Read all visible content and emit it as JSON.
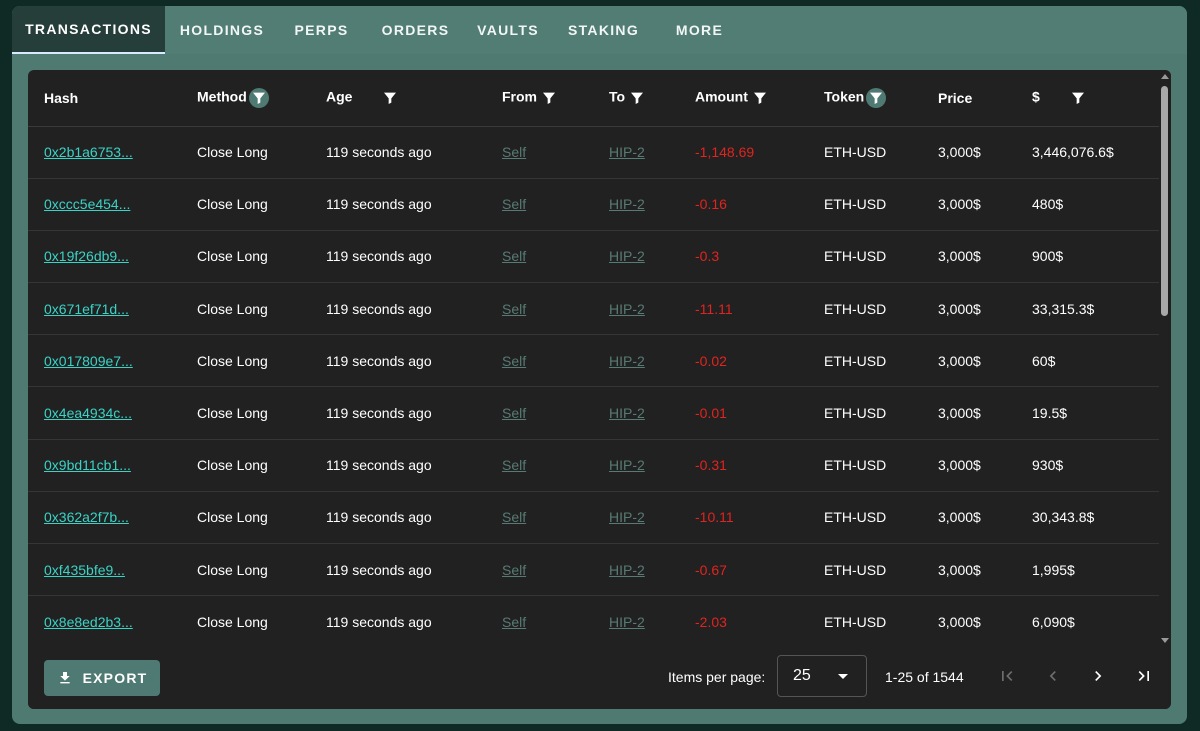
{
  "tabs": [
    {
      "label": "TRANSACTIONS",
      "active": true
    },
    {
      "label": "HOLDINGS"
    },
    {
      "label": "PERPS"
    },
    {
      "label": "ORDERS"
    },
    {
      "label": "VAULTS"
    },
    {
      "label": "STAKING"
    },
    {
      "label": "MORE"
    }
  ],
  "table": {
    "columns": [
      {
        "key": "hash",
        "label": "Hash",
        "filter": "none"
      },
      {
        "key": "method",
        "label": "Method",
        "filter": "filter-circle-icon"
      },
      {
        "key": "age",
        "label": "Age",
        "filter": "filter-icon"
      },
      {
        "key": "from",
        "label": "From",
        "filter": "filter-icon"
      },
      {
        "key": "to",
        "label": "To",
        "filter": "filter-icon"
      },
      {
        "key": "amount",
        "label": "Amount",
        "filter": "filter-icon"
      },
      {
        "key": "token",
        "label": "Token",
        "filter": "filter-circle-icon"
      },
      {
        "key": "price",
        "label": "Price",
        "filter": "none"
      },
      {
        "key": "usd",
        "label": "$",
        "filter": "filter-icon"
      }
    ],
    "rows": [
      {
        "hash": "0x2b1a6753...",
        "method": "Close Long",
        "age": "119 seconds ago",
        "from": "Self",
        "to": "HIP-2",
        "amount": "-1,148.69",
        "token": "ETH-USD",
        "price": "3,000$",
        "usd": "3,446,076.6$"
      },
      {
        "hash": "0xccc5e454...",
        "method": "Close Long",
        "age": "119 seconds ago",
        "from": "Self",
        "to": "HIP-2",
        "amount": "-0.16",
        "token": "ETH-USD",
        "price": "3,000$",
        "usd": "480$"
      },
      {
        "hash": "0x19f26db9...",
        "method": "Close Long",
        "age": "119 seconds ago",
        "from": "Self",
        "to": "HIP-2",
        "amount": "-0.3",
        "token": "ETH-USD",
        "price": "3,000$",
        "usd": "900$"
      },
      {
        "hash": "0x671ef71d...",
        "method": "Close Long",
        "age": "119 seconds ago",
        "from": "Self",
        "to": "HIP-2",
        "amount": "-11.11",
        "token": "ETH-USD",
        "price": "3,000$",
        "usd": "33,315.3$"
      },
      {
        "hash": "0x017809e7...",
        "method": "Close Long",
        "age": "119 seconds ago",
        "from": "Self",
        "to": "HIP-2",
        "amount": "-0.02",
        "token": "ETH-USD",
        "price": "3,000$",
        "usd": "60$"
      },
      {
        "hash": "0x4ea4934c...",
        "method": "Close Long",
        "age": "119 seconds ago",
        "from": "Self",
        "to": "HIP-2",
        "amount": "-0.01",
        "token": "ETH-USD",
        "price": "3,000$",
        "usd": "19.5$"
      },
      {
        "hash": "0x9bd11cb1...",
        "method": "Close Long",
        "age": "119 seconds ago",
        "from": "Self",
        "to": "HIP-2",
        "amount": "-0.31",
        "token": "ETH-USD",
        "price": "3,000$",
        "usd": "930$"
      },
      {
        "hash": "0x362a2f7b...",
        "method": "Close Long",
        "age": "119 seconds ago",
        "from": "Self",
        "to": "HIP-2",
        "amount": "-10.11",
        "token": "ETH-USD",
        "price": "3,000$",
        "usd": "30,343.8$"
      },
      {
        "hash": "0xf435bfe9...",
        "method": "Close Long",
        "age": "119 seconds ago",
        "from": "Self",
        "to": "HIP-2",
        "amount": "-0.67",
        "token": "ETH-USD",
        "price": "3,000$",
        "usd": "1,995$"
      },
      {
        "hash": "0x8e8ed2b3...",
        "method": "Close Long",
        "age": "119 seconds ago",
        "from": "Self",
        "to": "HIP-2",
        "amount": "-2.03",
        "token": "ETH-USD",
        "price": "3,000$",
        "usd": "6,090$"
      }
    ]
  },
  "footer": {
    "export_label": "EXPORT",
    "items_per_page_label": "Items per page:",
    "items_per_page_value": "25",
    "range_label": "1-25 of 1544"
  },
  "colors": {
    "accent": "#4f7a73",
    "link": "#3ad3c6",
    "negative": "#e0241f",
    "muted_link": "#587a74",
    "card_bg": "#212121"
  }
}
